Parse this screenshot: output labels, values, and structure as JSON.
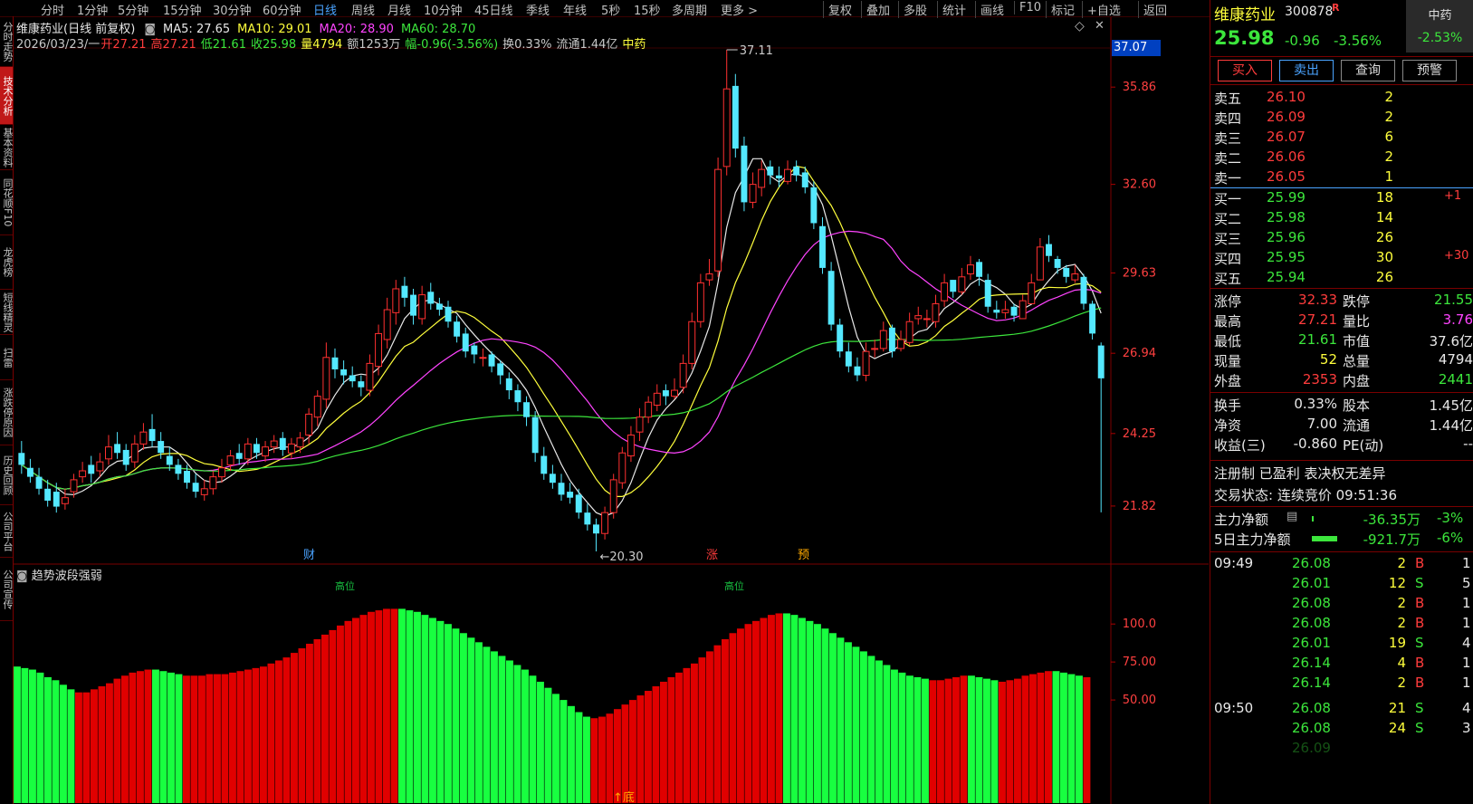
{
  "topbar": {
    "periods": [
      "分时",
      "1分钟",
      "5分钟",
      "15分钟",
      "30分钟",
      "60分钟",
      "日线",
      "周线",
      "月线",
      "10分钟",
      "45日线",
      "季线",
      "年线",
      "5秒",
      "15秒",
      "多周期",
      "更多 >"
    ],
    "active_period": "日线",
    "tools": [
      "复权",
      "叠加",
      "多股",
      "统计",
      "画线",
      "F10",
      "标记",
      "+自选",
      "返回"
    ]
  },
  "left_tabs": [
    {
      "label": "分时走势",
      "active": false
    },
    {
      "label": "技术分析",
      "active": true
    },
    {
      "label": "基本资料",
      "active": false
    },
    {
      "label": "同花顺F10",
      "active": false
    },
    {
      "label": "龙虎榜",
      "active": false
    },
    {
      "label": "短线精灵",
      "active": false
    },
    {
      "label": "扫雷",
      "active": false
    },
    {
      "label": "涨跌停原因",
      "active": false
    },
    {
      "label": "历史回顾",
      "active": false
    },
    {
      "label": "公司平台",
      "active": false
    },
    {
      "label": "公司宣传",
      "active": false
    }
  ],
  "header": {
    "title": "维康药业(日线 前复权)",
    "ma": [
      {
        "label": "MA5: 27.65",
        "color": "#e8e8e8"
      },
      {
        "label": "MA10: 29.01",
        "color": "#ffff3c"
      },
      {
        "label": "MA20: 28.90",
        "color": "#ff44ff"
      },
      {
        "label": "MA60: 28.70",
        "color": "#3ce63c"
      }
    ],
    "info": [
      {
        "t": "2026/03/23/一",
        "c": "#c8c8c8"
      },
      {
        "t": "开27.21",
        "c": "#ff3c3c"
      },
      {
        "t": "高27.21",
        "c": "#ff3c3c"
      },
      {
        "t": "低21.61",
        "c": "#3ce63c"
      },
      {
        "t": "收25.98",
        "c": "#3ce63c"
      },
      {
        "t": "量4794",
        "c": "#ffff3c"
      },
      {
        "t": "额1253万",
        "c": "#c8c8c8"
      },
      {
        "t": "幅-0.96(-3.56%)",
        "c": "#3ce63c"
      },
      {
        "t": "换0.33%",
        "c": "#c8c8c8"
      },
      {
        "t": "流通1.44亿",
        "c": "#c8c8c8"
      },
      {
        "t": "中药",
        "c": "#ffff3c"
      }
    ],
    "price_box": "37.07"
  },
  "chart_data": [
    {
      "type": "candlestick",
      "title": "维康药业(日线 前复权)",
      "y_ticks": [
        35.86,
        32.6,
        29.63,
        26.94,
        24.25,
        21.82
      ],
      "ylim": [
        20.3,
        37.11
      ],
      "annotations": [
        {
          "label": "37.11",
          "value": 37.11,
          "kind": "high"
        },
        {
          "label": "20.30",
          "value": 20.3,
          "kind": "low"
        }
      ],
      "markers": [
        {
          "label": "财",
          "color": "#4aa3ff"
        },
        {
          "label": "涨",
          "color": "#ff3c3c"
        },
        {
          "label": "预",
          "color": "#ffaa00"
        }
      ],
      "series_names": [
        "MA5",
        "MA10",
        "MA20",
        "MA60"
      ],
      "close": [
        23.2,
        22.8,
        22.4,
        22.0,
        21.8,
        22.1,
        22.7,
        23.0,
        22.9,
        23.3,
        23.8,
        23.6,
        23.2,
        23.9,
        24.3,
        24.0,
        23.6,
        23.2,
        22.9,
        22.6,
        22.3,
        22.4,
        22.8,
        23.1,
        23.5,
        23.4,
        23.9,
        23.6,
        23.8,
        24.0,
        23.7,
        23.9,
        24.1,
        24.9,
        25.5,
        26.8,
        26.4,
        26.2,
        26.0,
        25.8,
        26.6,
        27.6,
        28.4,
        29.1,
        28.8,
        28.2,
        28.9,
        28.6,
        28.4,
        28.0,
        27.5,
        27.0,
        26.9,
        26.8,
        26.5,
        26.2,
        25.7,
        25.3,
        24.8,
        23.6,
        22.9,
        22.6,
        22.2,
        22.1,
        21.6,
        21.2,
        20.9,
        21.6,
        22.7,
        23.6,
        24.2,
        24.8,
        25.3,
        25.6,
        25.5,
        25.7,
        26.6,
        28.0,
        29.3,
        29.6,
        33.1,
        35.8,
        33.8,
        32.0,
        32.6,
        33.1,
        32.9,
        32.8,
        33.1,
        32.9,
        32.5,
        31.3,
        29.8,
        27.9,
        27.0,
        26.5,
        26.2,
        27.0,
        27.1,
        27.7,
        27.0,
        27.4,
        28.0,
        28.2,
        28.1,
        28.6,
        29.3,
        29.0,
        29.5,
        29.9,
        29.5,
        28.5,
        28.3,
        28.4,
        28.2,
        28.7,
        29.3,
        30.5,
        30.2,
        29.8,
        29.5,
        29.6,
        28.6,
        27.6,
        26.1
      ],
      "open": [
        23.6,
        23.1,
        22.8,
        22.4,
        22.3,
        21.9,
        22.3,
        22.8,
        23.2,
        23.0,
        23.4,
        23.9,
        23.7,
        23.3,
        23.9,
        24.4,
        24.0,
        23.5,
        23.2,
        23.0,
        22.6,
        22.2,
        22.4,
        22.8,
        23.2,
        23.6,
        23.4,
        23.9,
        23.5,
        23.8,
        24.1,
        23.6,
        23.8,
        24.2,
        24.8,
        25.4,
        26.8,
        26.4,
        26.2,
        26.0,
        25.7,
        26.5,
        27.4,
        28.3,
        29.2,
        28.9,
        28.1,
        29.0,
        28.6,
        28.5,
        28.0,
        27.6,
        27.2,
        26.8,
        26.9,
        26.6,
        26.1,
        25.7,
        25.3,
        24.8,
        23.5,
        22.9,
        22.6,
        22.3,
        22.2,
        21.6,
        21.2,
        20.9,
        21.6,
        22.6,
        23.5,
        24.3,
        24.8,
        25.2,
        25.7,
        25.5,
        25.8,
        26.6,
        28.0,
        29.4,
        29.7,
        33.2,
        35.9,
        33.9,
        32.0,
        32.5,
        33.2,
        32.9,
        32.7,
        33.2,
        33.0,
        32.5,
        31.2,
        29.7,
        27.9,
        27.0,
        26.5,
        26.2,
        27.1,
        27.1,
        27.8,
        27.1,
        27.3,
        28.1,
        28.1,
        28.0,
        28.7,
        29.4,
        29.0,
        29.6,
        30.0,
        29.4,
        28.4,
        28.3,
        28.5,
        28.1,
        28.6,
        29.4,
        30.6,
        30.1,
        29.8,
        29.4,
        29.5,
        28.6,
        27.2
      ],
      "high": [
        24.0,
        23.4,
        23.1,
        22.7,
        22.6,
        22.4,
        22.9,
        23.3,
        23.5,
        23.6,
        24.2,
        24.3,
        23.9,
        24.2,
        24.6,
        24.9,
        24.3,
        23.8,
        23.4,
        23.2,
        22.9,
        22.7,
        23.0,
        23.4,
        23.7,
        23.9,
        24.1,
        24.1,
        24.0,
        24.2,
        24.3,
        24.1,
        24.3,
        25.1,
        25.7,
        27.3,
        27.1,
        26.7,
        26.5,
        26.2,
        26.9,
        27.9,
        28.8,
        29.4,
        29.5,
        29.1,
        29.2,
        29.3,
        28.8,
        28.7,
        28.2,
        27.8,
        27.3,
        27.1,
        27.0,
        26.7,
        26.3,
        25.9,
        25.5,
        25.0,
        23.8,
        23.2,
        22.9,
        22.6,
        22.4,
        21.9,
        21.4,
        21.8,
        22.9,
        23.8,
        24.5,
        25.1,
        25.5,
        25.9,
        25.9,
        26.1,
        26.9,
        28.3,
        29.6,
        30.1,
        33.5,
        37.11,
        36.3,
        34.2,
        33.0,
        33.4,
        33.4,
        33.2,
        33.4,
        33.4,
        33.2,
        32.7,
        31.5,
        30.0,
        28.1,
        27.3,
        26.8,
        27.3,
        27.4,
        28.0,
        27.9,
        27.7,
        28.3,
        28.5,
        28.4,
        28.9,
        29.6,
        29.4,
        29.8,
        30.2,
        30.1,
        29.6,
        28.7,
        28.7,
        28.6,
        28.9,
        29.6,
        30.8,
        30.9,
        30.2,
        29.9,
        29.9,
        29.6,
        28.7,
        27.3
      ],
      "low": [
        22.9,
        22.6,
        22.2,
        21.8,
        21.6,
        21.7,
        22.1,
        22.6,
        22.6,
        22.8,
        23.2,
        23.4,
        23.0,
        23.1,
        23.7,
        23.8,
        23.4,
        23.0,
        22.7,
        22.4,
        22.1,
        22.0,
        22.2,
        22.6,
        23.0,
        23.2,
        23.2,
        23.4,
        23.3,
        23.6,
        23.5,
        23.4,
        23.6,
        23.9,
        24.5,
        25.1,
        26.1,
        25.9,
        25.8,
        25.5,
        25.5,
        26.2,
        27.1,
        27.9,
        28.5,
        27.9,
        27.9,
        28.4,
        28.2,
        27.8,
        27.3,
        26.8,
        26.6,
        26.5,
        26.3,
        25.9,
        25.4,
        25.0,
        24.5,
        23.3,
        22.7,
        22.4,
        22.0,
        21.9,
        21.4,
        21.0,
        20.3,
        20.7,
        21.4,
        22.4,
        23.3,
        24.0,
        24.6,
        25.0,
        25.2,
        25.4,
        25.6,
        26.4,
        27.8,
        29.2,
        29.5,
        32.9,
        33.5,
        31.7,
        31.8,
        32.2,
        32.6,
        32.5,
        32.6,
        32.7,
        32.3,
        31.1,
        29.6,
        27.7,
        26.8,
        26.3,
        26.0,
        26.0,
        26.8,
        27.0,
        26.8,
        27.0,
        27.2,
        27.9,
        27.8,
        27.8,
        28.5,
        28.8,
        28.9,
        29.4,
        29.2,
        28.3,
        28.1,
        28.1,
        28.0,
        28.4,
        29.1,
        30.2,
        30.0,
        29.6,
        29.3,
        29.3,
        28.4,
        27.4,
        21.61
      ]
    },
    {
      "type": "bar",
      "title": "趋势波段强弱",
      "y_ticks": [
        100.0,
        75.0,
        50.0
      ],
      "annotations": [
        "高位",
        "高位",
        "底"
      ],
      "colors": {
        "up": "#e00000",
        "down": "#18ff40"
      },
      "values": [
        72,
        71,
        70,
        68,
        65,
        63,
        60,
        57,
        55,
        55,
        57,
        59,
        61,
        64,
        66,
        68,
        69,
        70,
        70,
        69,
        68,
        67,
        66,
        66,
        66,
        67,
        67,
        67,
        68,
        69,
        70,
        71,
        72,
        74,
        76,
        78,
        81,
        84,
        87,
        90,
        93,
        96,
        99,
        102,
        104,
        106,
        108,
        109,
        110,
        110,
        110,
        109,
        108,
        106,
        104,
        102,
        100,
        97,
        94,
        91,
        88,
        85,
        82,
        79,
        76,
        73,
        70,
        66,
        62,
        58,
        54,
        50,
        46,
        42,
        39,
        38,
        39,
        41,
        44,
        47,
        50,
        53,
        56,
        59,
        62,
        65,
        68,
        71,
        74,
        78,
        82,
        86,
        90,
        94,
        97,
        100,
        102,
        104,
        106,
        107,
        107,
        106,
        104,
        102,
        100,
        97,
        94,
        91,
        88,
        85,
        82,
        79,
        76,
        73,
        70,
        68,
        66,
        65,
        64,
        63,
        63,
        64,
        65,
        66,
        66,
        65,
        64,
        63,
        62,
        63,
        64,
        66,
        67,
        68,
        69,
        69,
        68,
        67,
        66,
        65
      ]
    }
  ],
  "quote": {
    "name": "维康药业",
    "code": "300878",
    "flag": "R",
    "sector": "中药",
    "sector_change": "-2.53%",
    "price": "25.98",
    "change": "-0.96",
    "pct": "-3.56%",
    "buttons": [
      "买入",
      "卖出",
      "查询",
      "预警"
    ],
    "sells": [
      {
        "label": "卖五",
        "price": "26.10",
        "vol": "2"
      },
      {
        "label": "卖四",
        "price": "26.09",
        "vol": "2"
      },
      {
        "label": "卖三",
        "price": "26.07",
        "vol": "6"
      },
      {
        "label": "卖二",
        "price": "26.06",
        "vol": "2"
      },
      {
        "label": "卖一",
        "price": "26.05",
        "vol": "1"
      }
    ],
    "buys": [
      {
        "label": "买一",
        "price": "25.99",
        "vol": "18",
        "extra": "+1"
      },
      {
        "label": "买二",
        "price": "25.98",
        "vol": "14",
        "extra": ""
      },
      {
        "label": "买三",
        "price": "25.96",
        "vol": "26",
        "extra": ""
      },
      {
        "label": "买四",
        "price": "25.95",
        "vol": "30",
        "extra": "+30"
      },
      {
        "label": "买五",
        "price": "25.94",
        "vol": "26",
        "extra": ""
      }
    ],
    "stats": [
      {
        "l1": "涨停",
        "v1": "32.33",
        "c1": "#ff3c3c",
        "l2": "跌停",
        "v2": "21.55",
        "c2": "#3ce63c"
      },
      {
        "l1": "最高",
        "v1": "27.21",
        "c1": "#ff3c3c",
        "l2": "量比",
        "v2": "3.76",
        "c2": "#ff44ff"
      },
      {
        "l1": "最低",
        "v1": "21.61",
        "c1": "#3ce63c",
        "l2": "市值",
        "v2": "37.6亿",
        "c2": "#e8e8e8"
      },
      {
        "l1": "现量",
        "v1": "52",
        "c1": "#ffff3c",
        "l2": "总量",
        "v2": "4794",
        "c2": "#e8e8e8"
      },
      {
        "l1": "外盘",
        "v1": "2353",
        "c1": "#ff3c3c",
        "l2": "内盘",
        "v2": "2441",
        "c2": "#3ce63c"
      }
    ],
    "stats2": [
      {
        "l1": "换手",
        "v1": "0.33%",
        "l2": "股本",
        "v2": "1.45亿"
      },
      {
        "l1": "净资",
        "v1": "7.00",
        "l2": "流通",
        "v2": "1.44亿"
      },
      {
        "l1": "收益(三)",
        "v1": "-0.860",
        "l2": "PE(动)",
        "v2": "--"
      }
    ],
    "tags": "注册制 已盈利 表决权无差异",
    "trade_status_label": "交易状态:",
    "trade_status": "连续竞价",
    "trade_time": "09:51:36",
    "flows": [
      {
        "label": "主力净额",
        "val": "-36.35万",
        "pct": "-3%"
      },
      {
        "label": "5日主力净额",
        "val": "-921.7万",
        "pct": "-6%"
      }
    ],
    "ticks": [
      {
        "time": "09:49",
        "price": "26.08",
        "vol": "2",
        "side": "B",
        "n": "1"
      },
      {
        "time": "",
        "price": "26.01",
        "vol": "12",
        "side": "S",
        "n": "5"
      },
      {
        "time": "",
        "price": "26.08",
        "vol": "2",
        "side": "B",
        "n": "1"
      },
      {
        "time": "",
        "price": "26.08",
        "vol": "2",
        "side": "B",
        "n": "1"
      },
      {
        "time": "",
        "price": "26.01",
        "vol": "19",
        "side": "S",
        "n": "4"
      },
      {
        "time": "",
        "price": "26.14",
        "vol": "4",
        "side": "B",
        "n": "1"
      },
      {
        "time": "",
        "price": "26.14",
        "vol": "2",
        "side": "B",
        "n": "1"
      },
      {
        "time": "09:50",
        "price": "26.08",
        "vol": "21",
        "side": "S",
        "n": "4"
      },
      {
        "time": "",
        "price": "26.08",
        "vol": "24",
        "side": "S",
        "n": "3"
      },
      {
        "time": "",
        "price": "26.09",
        "vol": "",
        "side": "",
        "n": ""
      }
    ]
  }
}
